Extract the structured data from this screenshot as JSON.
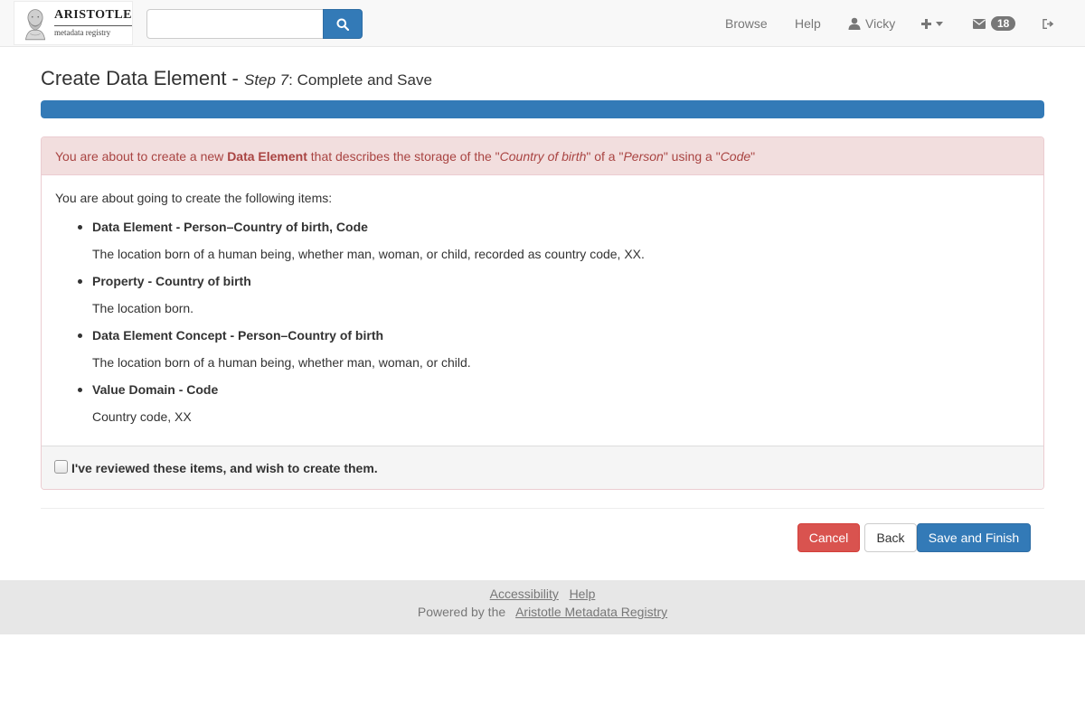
{
  "navbar": {
    "logo": {
      "title": "ARISTOTLE",
      "subtitle": "metadata registry"
    },
    "search": {
      "value": "",
      "placeholder": ""
    },
    "links": {
      "browse": "Browse",
      "help": "Help",
      "user": "Vicky",
      "unread_count": "18"
    },
    "icons": [
      "search-icon",
      "user-icon",
      "plus-icon",
      "envelope-icon",
      "sign-out-icon"
    ]
  },
  "page": {
    "title": "Create Data Element - ",
    "step": "Step 7",
    "step_suffix": ": Complete and Save",
    "progress_percent": 100
  },
  "warning": {
    "prefix": "You are about to create a new ",
    "type": "Data Element",
    "mid1": " that describes the storage of the \"",
    "property": "Country of birth",
    "mid2": "\" of a \"",
    "class": "Person",
    "mid3": "\" using a \"",
    "representation": "Code",
    "suffix": "\""
  },
  "review": {
    "intro": "You are about going to create the following items:",
    "items": [
      {
        "title": "Data Element - Person–Country of birth, Code",
        "description": "The location born of a human being, whether man, woman, or child, recorded as country code, XX."
      },
      {
        "title": "Property - Country of birth",
        "description": "The location born."
      },
      {
        "title": "Data Element Concept - Person–Country of birth",
        "description": "The location born of a human being, whether man, woman, or child."
      },
      {
        "title": "Value Domain - Code",
        "description": "Country code, XX"
      }
    ],
    "confirm_label": "I've reviewed these items, and wish to create them.",
    "confirm_checked": false
  },
  "actions": {
    "cancel": "Cancel",
    "back": "Back",
    "save": "Save and Finish"
  },
  "footer": {
    "accessibility": "Accessibility",
    "help": "Help",
    "powered_by": "Powered by the",
    "registry_link": "Aristotle Metadata Registry"
  },
  "colors": {
    "primary": "#337ab7",
    "danger": "#d9534f",
    "warning_bg": "#f2dede",
    "warning_text": "#a94442"
  }
}
